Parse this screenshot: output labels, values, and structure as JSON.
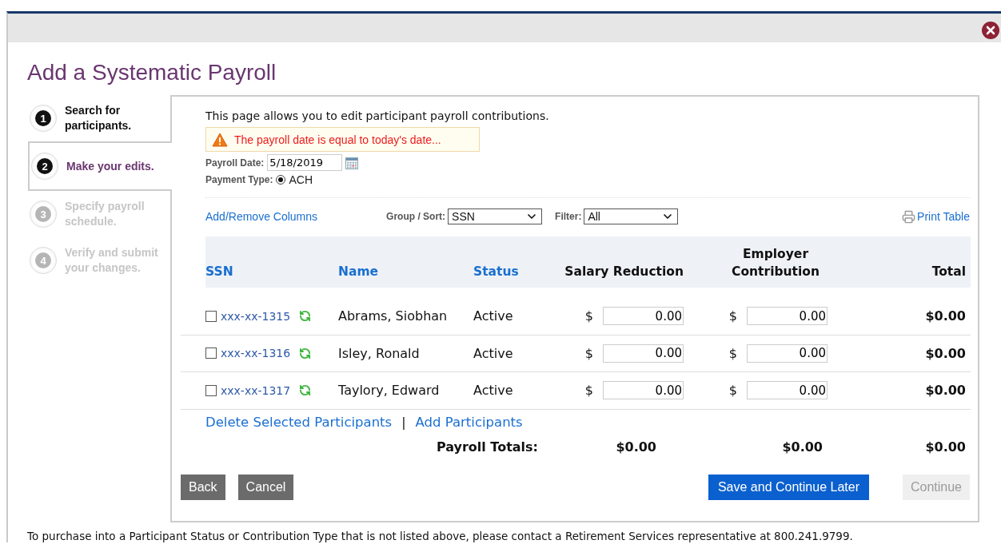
{
  "dialog": {
    "title": "Add a Systematic Payroll"
  },
  "steps": [
    {
      "number": "1",
      "label": "Search for participants.",
      "selected": false,
      "disabled": false
    },
    {
      "number": "2",
      "label": "Make your edits.",
      "selected": true,
      "disabled": false
    },
    {
      "number": "3",
      "label": "Specify payroll schedule.",
      "selected": false,
      "disabled": true
    },
    {
      "number": "4",
      "label": "Verify and submit your changes.",
      "selected": false,
      "disabled": true
    }
  ],
  "intro": "This page allows you to edit participant payroll contributions.",
  "warning": "The payroll date is equal to today's date...",
  "payroll_date": {
    "label": "Payroll Date:",
    "value": "5/18/2019"
  },
  "payment_type": {
    "label": "Payment Type:",
    "options": [
      {
        "label": "ACH",
        "selected": true
      }
    ]
  },
  "toolbar": {
    "columns_link": "Add/Remove Columns",
    "group_sort": {
      "label": "Group / Sort:",
      "value": "SSN"
    },
    "filter": {
      "label": "Filter:",
      "value": "All"
    },
    "print_link": "Print Table"
  },
  "table": {
    "columns": [
      {
        "label": "SSN",
        "kind": "link"
      },
      {
        "label": "Name",
        "kind": "link"
      },
      {
        "label": "Status",
        "kind": "link"
      },
      {
        "label": "Salary Reduction",
        "kind": "plain"
      },
      {
        "label": "Employer Contribution",
        "kind": "plain"
      },
      {
        "label": "Total",
        "kind": "plain"
      }
    ],
    "rows": [
      {
        "selected": false,
        "ssn": "xxx-xx-1315",
        "name": "Abrams, Siobhan",
        "status": "Active",
        "salary_currency": "$",
        "salary_reduction": "0.00",
        "employer_currency": "$",
        "employer_contribution": "0.00",
        "total": "$0.00"
      },
      {
        "selected": false,
        "ssn": "xxx-xx-1316",
        "name": "Isley, Ronald",
        "status": "Active",
        "salary_currency": "$",
        "salary_reduction": "0.00",
        "employer_currency": "$",
        "employer_contribution": "0.00",
        "total": "$0.00"
      },
      {
        "selected": false,
        "ssn": "xxx-xx-1317",
        "name": "Taylory, Edward",
        "status": "Active",
        "salary_currency": "$",
        "salary_reduction": "0.00",
        "employer_currency": "$",
        "employer_contribution": "0.00",
        "total": "$0.00"
      }
    ]
  },
  "table_links": {
    "delete": "Delete Selected Participants",
    "separator": "|",
    "add": "Add Participants"
  },
  "totals": {
    "label": "Payroll Totals:",
    "values": [
      "$0.00",
      "$0.00",
      "$0.00"
    ]
  },
  "buttons": [
    {
      "label": "Back",
      "kind": "secondary",
      "disabled": false
    },
    {
      "label": "Cancel",
      "kind": "secondary",
      "disabled": false
    },
    {
      "label": "Save and Continue Later",
      "kind": "primary",
      "disabled": false
    },
    {
      "label": "Continue",
      "kind": "primary",
      "disabled": true
    }
  ],
  "footer_note": "To purchase into a Participant Status or Contribution Type that is not listed above, please contact a Retirement Services representative at 800.241.9799."
}
